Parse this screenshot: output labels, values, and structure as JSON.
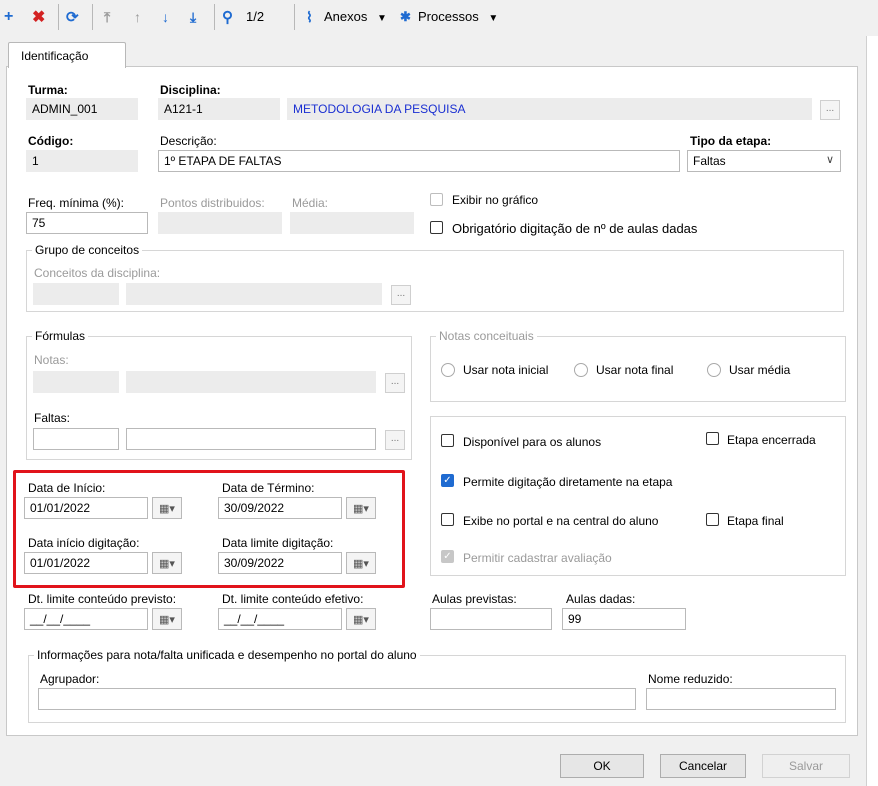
{
  "toolbar": {
    "page_indicator": "1/2",
    "anexos_label": "Anexos",
    "processos_label": "Processos"
  },
  "tab_identificacao": "Identificação",
  "turma": {
    "label": "Turma:",
    "value": "ADMIN_001"
  },
  "disciplina": {
    "label": "Disciplina:",
    "code": "A121-1",
    "name": "METODOLOGIA DA PESQUISA"
  },
  "codigo": {
    "label": "Código:",
    "value": "1"
  },
  "descricao": {
    "label": "Descrição:",
    "value": "1º ETAPA DE FALTAS"
  },
  "tipo_etapa": {
    "label": "Tipo da etapa:",
    "value": "Faltas"
  },
  "freq_minima": {
    "label": "Freq. mínima (%):",
    "value": "75"
  },
  "pontos_distribuidos": {
    "label": "Pontos distribuidos:"
  },
  "media": {
    "label": "Média:"
  },
  "exibir_grafico": {
    "label": "Exibir no gráfico",
    "checked": false,
    "disabled": true
  },
  "obrigatorio_aulas": {
    "label": "Obrigatório digitação de nº de aulas dadas",
    "checked": false
  },
  "grupo_conceitos": {
    "title": "Grupo de conceitos",
    "conceitos_label": "Conceitos da disciplina:"
  },
  "formulas": {
    "title": "Fórmulas",
    "notas_label": "Notas:",
    "faltas_label": "Faltas:"
  },
  "notas_conceituais": {
    "title": "Notas conceituais",
    "options": [
      "Usar nota inicial",
      "Usar nota final",
      "Usar média"
    ]
  },
  "opcoes": {
    "disponivel_alunos": "Disponível para os alunos",
    "etapa_encerrada": "Etapa encerrada",
    "permite_digitacao": "Permite digitação diretamente na etapa",
    "exibe_portal": "Exibe no portal e na central do aluno",
    "etapa_final": "Etapa final",
    "permitir_avaliacao": "Permitir cadastrar avaliação"
  },
  "datas": {
    "inicio_label": "Data de Início:",
    "inicio_value": "01/01/2022",
    "termino_label": "Data de Término:",
    "termino_value": "30/09/2022",
    "inicio_digitacao_label": "Data início digitação:",
    "inicio_digitacao_value": "01/01/2022",
    "limite_digitacao_label": "Data limite digitação:",
    "limite_digitacao_value": "30/09/2022",
    "limite_previsto_label": "Dt. limite conteúdo previsto:",
    "limite_previsto_value": "__/__/____",
    "limite_efetivo_label": "Dt. limite conteúdo efetivo:",
    "limite_efetivo_value": "__/__/____"
  },
  "aulas_previstas": {
    "label": "Aulas previstas:",
    "value": ""
  },
  "aulas_dadas": {
    "label": "Aulas dadas:",
    "value": "99"
  },
  "info_unificada": {
    "title": "Informações para nota/falta unificada e desempenho no portal do aluno",
    "agrupador_label": "Agrupador:",
    "nome_reduzido_label": "Nome reduzido:"
  },
  "buttons": {
    "ok": "OK",
    "cancelar": "Cancelar",
    "salvar": "Salvar"
  },
  "colors": {
    "highlight": "#e1131b",
    "accent": "#1f6bd1",
    "link_text": "#1a2fd2"
  }
}
